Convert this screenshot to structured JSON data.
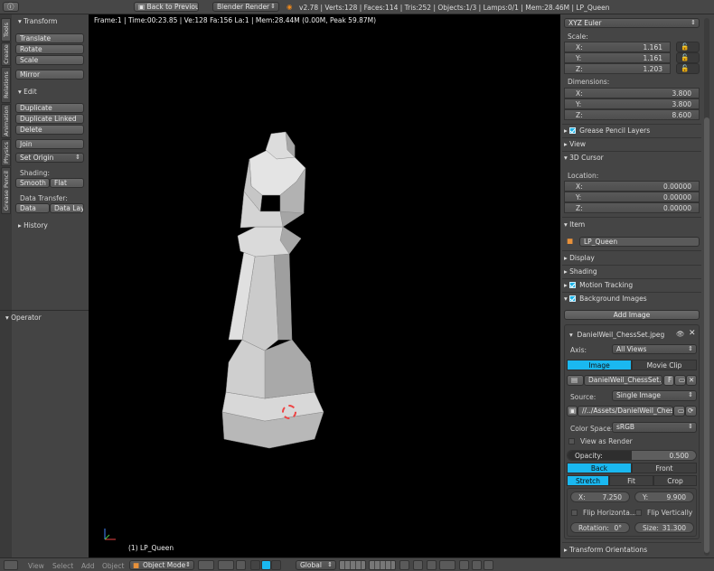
{
  "topbar": {
    "back_label": "Back to Previous",
    "engine": "Blender Render",
    "stats": "v2.78 | Verts:128 | Faces:114 | Tris:252 | Objects:1/3 | Lamps:0/1 | Mem:28.46M | LP_Queen"
  },
  "viewport": {
    "info": "Frame:1 | Time:00:23.85 | Ve:128 Fa:156 La:1 | Mem:28.44M (0.00M, Peak 59.87M)",
    "object_label": "(1) LP_Queen"
  },
  "tabs": [
    "Tools",
    "Create",
    "Relations",
    "Animation",
    "Physics",
    "Grease Pencil"
  ],
  "toolshelf": {
    "transform": {
      "title": "Transform",
      "translate": "Translate",
      "rotate": "Rotate",
      "scale": "Scale",
      "mirror": "Mirror"
    },
    "edit": {
      "title": "Edit",
      "duplicate": "Duplicate",
      "duplicate_linked": "Duplicate Linked",
      "delete": "Delete",
      "join": "Join",
      "set_origin": "Set Origin",
      "shading_label": "Shading:",
      "smooth": "Smooth",
      "flat": "Flat",
      "data_transfer_label": "Data Transfer:",
      "data": "Data",
      "data_layo": "Data Layo"
    },
    "history": "History",
    "operator": "Operator"
  },
  "properties": {
    "rotation_mode": "XYZ Euler",
    "scale_label": "Scale:",
    "scale": {
      "x": "1.161",
      "y": "1.161",
      "z": "1.203"
    },
    "dimensions_label": "Dimensions:",
    "dimensions": {
      "x": "3.800",
      "y": "3.800",
      "z": "8.600"
    },
    "axis": {
      "x": "X:",
      "y": "Y:",
      "z": "Z:"
    },
    "grease_pencil_layers": "Grease Pencil Layers",
    "view": "View",
    "cursor": "3D Cursor",
    "location_label": "Location:",
    "location": {
      "x": "0.00000",
      "y": "0.00000",
      "z": "0.00000"
    },
    "item": "Item",
    "item_name": "LP_Queen",
    "display": "Display",
    "shading": "Shading",
    "motion_tracking": "Motion Tracking",
    "background_images": "Background Images",
    "add_image": "Add Image",
    "bg": {
      "name": "DanielWeil_ChessSet.jpeg",
      "axis_label": "Axis:",
      "axis_value": "All Views",
      "image_tab": "Image",
      "movie_tab": "Movie Clip",
      "file": "DanielWeil_ChessSet.jpeg",
      "f": "F",
      "source_label": "Source:",
      "source_value": "Single Image",
      "path": "//../Assets/DanielWeil_ChessSet...",
      "color_space_label": "Color Space:",
      "color_space": "sRGB",
      "view_as_render": "View as Render",
      "opacity_label": "Opacity:",
      "opacity": "0.500",
      "back": "Back",
      "front": "Front",
      "stretch": "Stretch",
      "fit": "Fit",
      "crop": "Crop",
      "x_label": "X:",
      "x": "7.250",
      "y_label": "Y:",
      "y": "9.900",
      "flip_h": "Flip Horizonta...",
      "flip_v": "Flip Vertically",
      "rotation_label": "Rotation:",
      "rotation": "0°",
      "size_label": "Size:",
      "size": "31.300"
    },
    "transform_orientations": "Transform Orientations"
  },
  "bottombar": {
    "view": "View",
    "select": "Select",
    "add": "Add",
    "object": "Object",
    "mode": "Object Mode",
    "orientation": "Global"
  },
  "colors": {
    "accent": "#1ab8f0",
    "viewport": "#000000",
    "panel": "#454545"
  }
}
